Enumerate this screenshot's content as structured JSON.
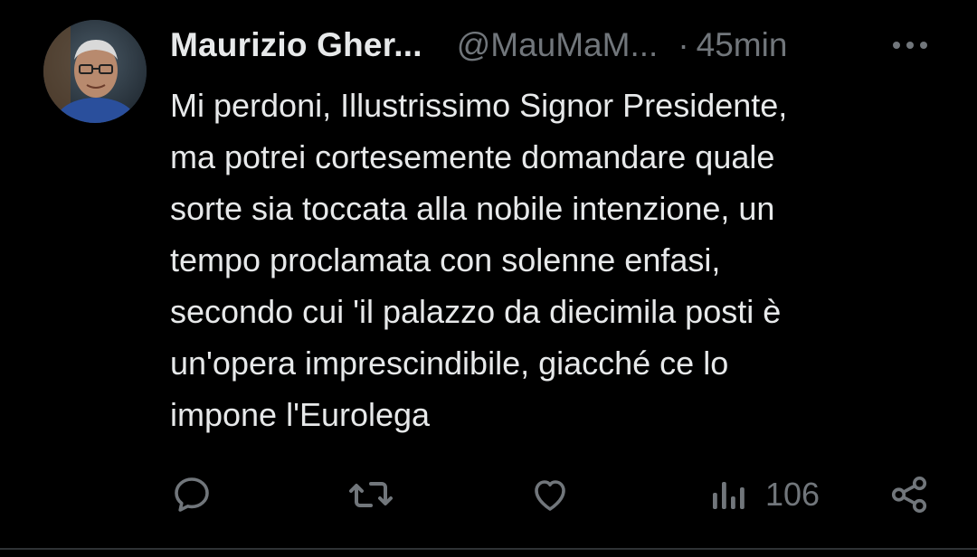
{
  "tweet": {
    "author": {
      "display_name": "Maurizio Gher...",
      "handle": "@MauMaM...",
      "avatar": "avatar-photo"
    },
    "separator": "·",
    "time": "45min",
    "more_icon": "more-horizontal-icon",
    "text": "Mi perdoni, Illustrissimo Signor Presidente,\nma potrei cortesemente domandare quale\nsorte sia toccata alla nobile intenzione, un\ntempo proclamata con solenne enfasi,\nsecondo cui 'il palazzo da diecimila posti è\nun'opera imprescindibile, giacché ce lo\nimpone l'Eurolega",
    "actions": {
      "reply_icon": "reply-icon",
      "retweet_icon": "retweet-icon",
      "like_icon": "heart-icon",
      "views_icon": "views-icon",
      "views_count": "106",
      "share_icon": "share-icon"
    }
  },
  "colors": {
    "background": "#000000",
    "primary_text": "#e7e9ea",
    "secondary_text": "#71767b",
    "divider": "#2f3336"
  }
}
